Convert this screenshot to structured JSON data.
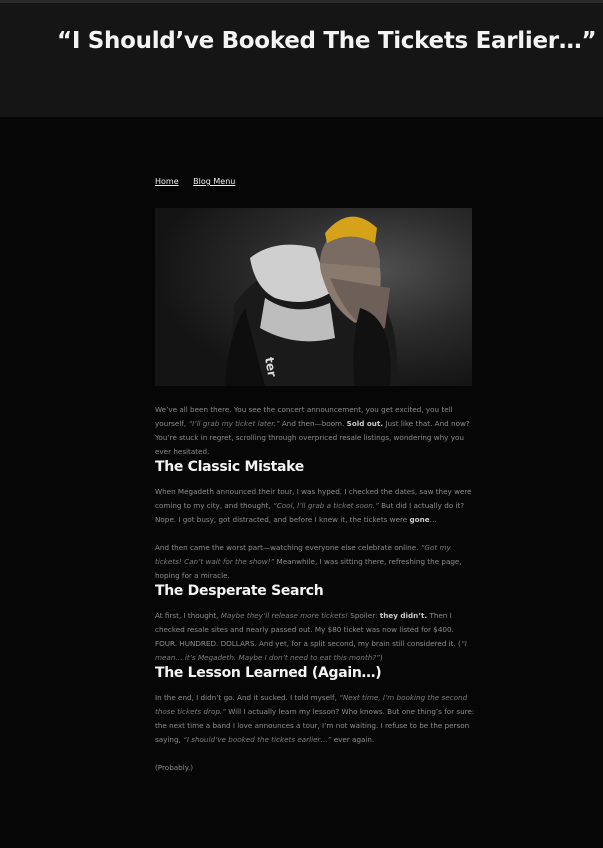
{
  "page": {
    "title": "“I Should’ve Booked The Tickets Earlier…”"
  },
  "nav": {
    "home": "Home",
    "blog_menu": "Blog Menu"
  },
  "intro": {
    "a": "We’ve all been there. You see the concert announcement, you get excited, you tell yourself, ",
    "b": "“I’ll grab my ticket later.”",
    "c": " And then—boom. ",
    "d": "Sold out.",
    "e": " Just like that. And now? You’re stuck in regret, scrolling through overpriced resale listings, wondering why you ever hesitated."
  },
  "s1": {
    "heading": "The Classic Mistake",
    "p1a": "When Megadeth announced their tour, I was hyped. I checked the dates, saw they were coming to my city, and thought, ",
    "p1b": "“Cool, I’ll grab a ticket soon.”",
    "p1c": " But did I actually do it? Nope. I got busy, got distracted, and before I knew it, the tickets were ",
    "p1d": "gone",
    "p1e": "…",
    "p2a": "And then came the worst part—watching everyone else celebrate online. ",
    "p2b": "“Got my tickets! Can’t wait for the show!”",
    "p2c": " Meanwhile, I was sitting there, refreshing the page, hoping for a miracle."
  },
  "s2": {
    "heading": "The Desperate Search",
    "a": "At first, I thought, ",
    "b": "Maybe they’ll release more tickets!",
    "c": " Spoiler: ",
    "d": "they didn’t.",
    "e": " Then I checked resale sites and nearly passed out. My $80 ticket was now listed for $400. FOUR. HUNDRED. DOLLARS. And yet, for a split second, my brain still considered it. (",
    "f": "“I mean… it’s Megadeth. Maybe I don’t need to eat this month?”",
    "g": ")"
  },
  "s3": {
    "heading": "The Lesson Learned (Again…)",
    "a": "In the end, I didn’t go. And it sucked. I told myself, ",
    "b": "“Next time, I’m booking the second those tickets drop.”",
    "c": " Will I actually learn my lesson? Who knows. But one thing’s for sure: the next time a band I love announces a tour, I’m not waiting. I refuse to be the person saying, ",
    "d": "“I should’ve booked the tickets earlier…”",
    "e": " ever again.",
    "closing": "(Probably.)"
  },
  "colors": {
    "background": "#060606",
    "header": "#151515",
    "heading": "#f4f4f4",
    "body_text": "#8d8d8d",
    "beanie": "#d6a21a"
  },
  "hero_image": {
    "icon": "person-covering-face-photo"
  }
}
